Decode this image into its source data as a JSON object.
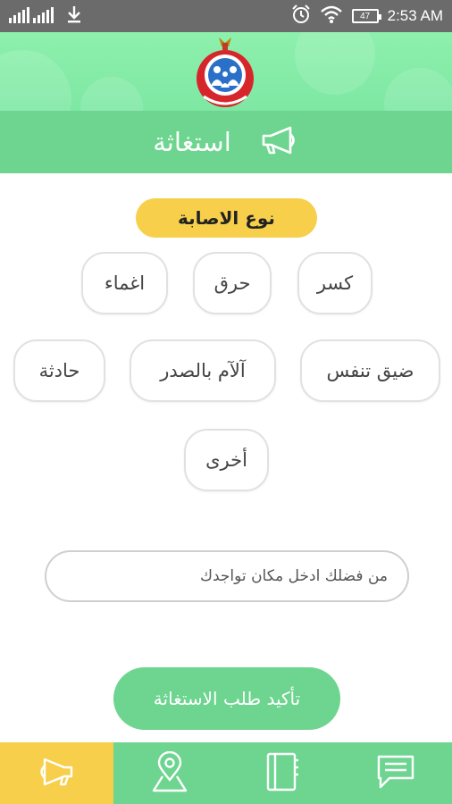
{
  "status_bar": {
    "time": "2:53 AM",
    "battery": "47",
    "icons": [
      "signal-icon",
      "download-icon",
      "alarm-icon",
      "wifi-icon",
      "battery-icon"
    ]
  },
  "header": {
    "logo": "ministry-of-health-logo",
    "title": "استغاثة",
    "title_icon": "megaphone-icon"
  },
  "injury_type": {
    "label": "نوع الاصابة",
    "options": [
      "كسر",
      "حرق",
      "اغماء",
      "ضيق تنفس",
      "آلآم بالصدر",
      "حادثة",
      "أخرى"
    ]
  },
  "location": {
    "placeholder": "من فضلك ادخل مكان تواجدك",
    "value": ""
  },
  "confirm_label": "تأكيد طلب الاستغاثة",
  "bottom_nav": {
    "items": [
      {
        "icon": "megaphone-icon",
        "active": true
      },
      {
        "icon": "location-pin-icon",
        "active": false
      },
      {
        "icon": "notebook-icon",
        "active": false
      },
      {
        "icon": "message-icon",
        "active": false
      }
    ]
  },
  "colors": {
    "primary_green": "#6dd58f",
    "accent_yellow": "#f7cf4a",
    "status_bar": "#6b6b6b"
  }
}
